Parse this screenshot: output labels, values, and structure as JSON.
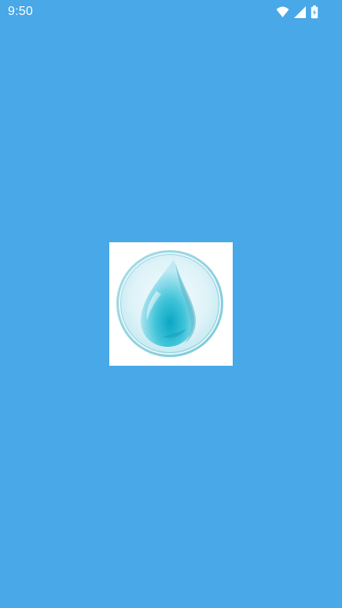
{
  "status_bar": {
    "time": "9:50",
    "icons": [
      "wifi-icon",
      "cell-signal-icon",
      "battery-charging-icon"
    ]
  },
  "splash": {
    "logo_icon": "water-drop-icon"
  },
  "colors": {
    "background": "#48a8e8",
    "status_text": "#ffffff",
    "logo_tile": "#ffffff"
  }
}
